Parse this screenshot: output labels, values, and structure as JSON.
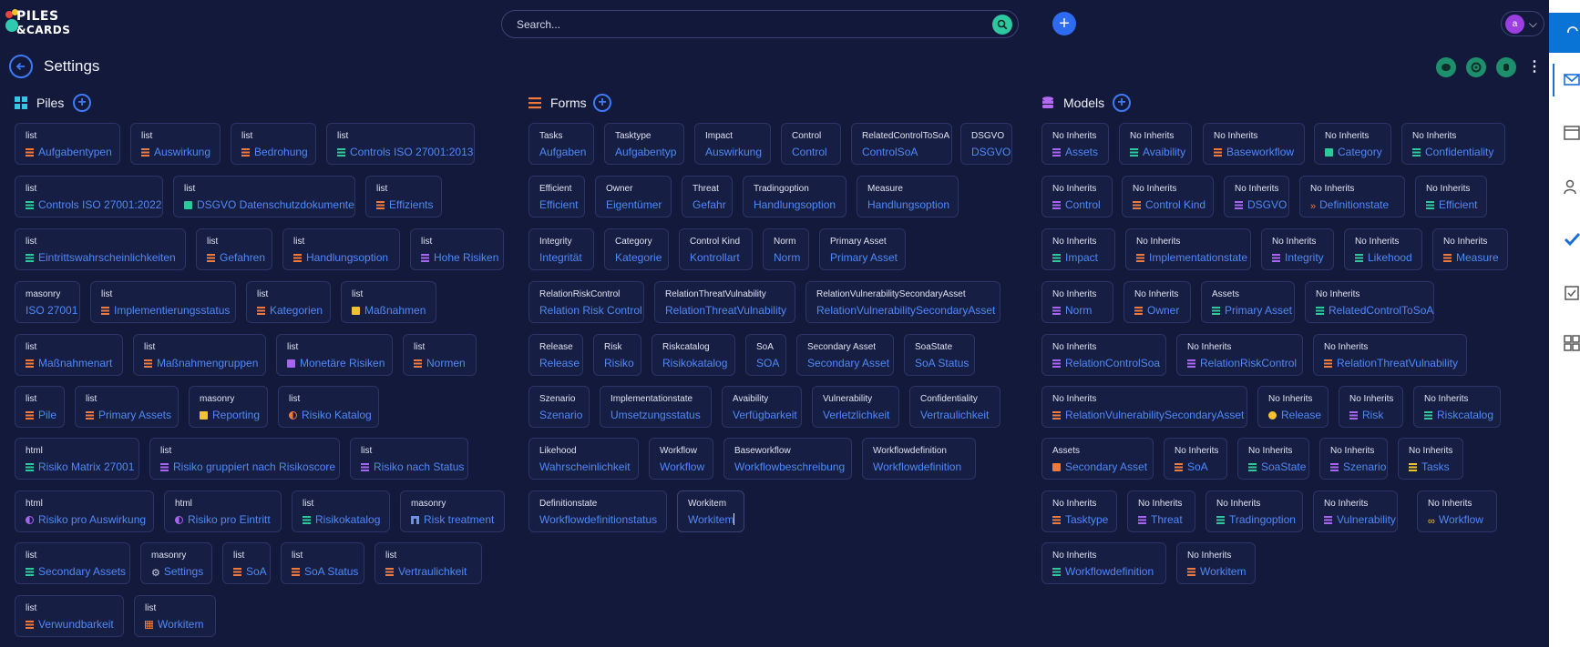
{
  "logo": {
    "line1": "PILES",
    "line2": "&CARDS"
  },
  "search": {
    "placeholder": "Search..."
  },
  "user": {
    "initial": "a"
  },
  "header": {
    "title": "Settings"
  },
  "colors": {
    "accent": "#3d7bf6",
    "green": "#2dc8a0",
    "orange": "#f0793c",
    "purple": "#a865f0",
    "teal": "#2fc89a",
    "yellow": "#f2c230",
    "link": "#4f89f7"
  },
  "columns": {
    "piles": {
      "title": "Piles",
      "icon": "grid-icon"
    },
    "forms": {
      "title": "Forms",
      "icon": "list-icon"
    },
    "models": {
      "title": "Models",
      "icon": "database-icon"
    }
  },
  "piles": [
    {
      "sub": "list",
      "name": "Aufgabentypen",
      "icon": "lines",
      "color": "#f0793c"
    },
    {
      "sub": "list",
      "name": "Auswirkung",
      "icon": "lines",
      "color": "#f0793c"
    },
    {
      "sub": "list",
      "name": "Bedrohung",
      "icon": "lines",
      "color": "#f0793c"
    },
    {
      "sub": "list",
      "name": "Controls ISO 27001:2013",
      "icon": "lines",
      "color": "#2fc89a"
    },
    {
      "sub": "list",
      "name": "Controls ISO 27001:2022",
      "icon": "lines",
      "color": "#2fc89a"
    },
    {
      "sub": "list",
      "name": "DSGVO Datenschutzdokumente",
      "icon": "solid",
      "color": "#2fc89a"
    },
    {
      "sub": "list",
      "name": "Effizients",
      "icon": "lines",
      "color": "#f0793c"
    },
    {
      "sub": "list",
      "name": "Eintrittswahrscheinlichkeiten",
      "icon": "lines",
      "color": "#2fc89a"
    },
    {
      "sub": "list",
      "name": "Gefahren",
      "icon": "lines",
      "color": "#f0793c"
    },
    {
      "sub": "list",
      "name": "Handlungsoption",
      "icon": "lines",
      "color": "#f0793c"
    },
    {
      "sub": "list",
      "name": "Hohe Risiken",
      "icon": "lines",
      "color": "#a865f0"
    },
    {
      "sub": "masonry",
      "name": "ISO 27001",
      "icon": "none",
      "color": ""
    },
    {
      "sub": "list",
      "name": "Implementierungsstatus",
      "icon": "lines",
      "color": "#f0793c"
    },
    {
      "sub": "list",
      "name": "Kategorien",
      "icon": "lines",
      "color": "#f0793c"
    },
    {
      "sub": "list",
      "name": "Maßnahmen",
      "icon": "solid",
      "color": "#f2c230"
    },
    {
      "sub": "list",
      "name": "Maßnahmenart",
      "icon": "lines",
      "color": "#f0793c"
    },
    {
      "sub": "list",
      "name": "Maßnahmengruppen",
      "icon": "lines",
      "color": "#f0793c"
    },
    {
      "sub": "list",
      "name": "Monetäre Risiken",
      "icon": "solid",
      "color": "#a865f0"
    },
    {
      "sub": "list",
      "name": "Normen",
      "icon": "lines",
      "color": "#f0793c"
    },
    {
      "sub": "list",
      "name": "Pile",
      "icon": "lines",
      "color": "#f0793c"
    },
    {
      "sub": "list",
      "name": "Primary Assets",
      "icon": "lines",
      "color": "#f0793c"
    },
    {
      "sub": "masonry",
      "name": "Reporting",
      "icon": "solid",
      "color": "#f2c230"
    },
    {
      "sub": "list",
      "name": "Risiko Katalog",
      "icon": "half",
      "color": "#f0793c"
    },
    {
      "sub": "html",
      "name": "Risiko Matrix 27001",
      "icon": "lines",
      "color": "#2fc89a"
    },
    {
      "sub": "list",
      "name": "Risiko gruppiert nach Risikoscore",
      "icon": "lines",
      "color": "#a865f0"
    },
    {
      "sub": "list",
      "name": "Risiko nach Status",
      "icon": "lines",
      "color": "#a865f0"
    },
    {
      "sub": "html",
      "name": "Risiko pro Auswirkung",
      "icon": "half",
      "color": "#a865f0"
    },
    {
      "sub": "html",
      "name": "Risiko pro Eintritt",
      "icon": "half",
      "color": "#a865f0"
    },
    {
      "sub": "list",
      "name": "Risikokatalog",
      "icon": "lines",
      "color": "#2fc89a"
    },
    {
      "sub": "masonry",
      "name": "Risk treatment",
      "icon": "house",
      "color": "#6f8fe8"
    },
    {
      "sub": "list",
      "name": "Secondary Assets",
      "icon": "lines",
      "color": "#2fc89a"
    },
    {
      "sub": "masonry",
      "name": "Settings",
      "icon": "glyph",
      "color": "#c9cde0"
    },
    {
      "sub": "list",
      "name": "SoA",
      "icon": "lines",
      "color": "#f0793c"
    },
    {
      "sub": "list",
      "name": "SoA Status",
      "icon": "lines",
      "color": "#f0793c"
    },
    {
      "sub": "list",
      "name": "Vertraulichkeit",
      "icon": "lines",
      "color": "#f0793c"
    },
    {
      "sub": "list",
      "name": "Verwundbarkeit",
      "icon": "lines",
      "color": "#f0793c"
    },
    {
      "sub": "list",
      "name": "Workitem",
      "icon": "grid",
      "color": "#f0793c"
    }
  ],
  "forms": [
    {
      "sub": "Tasks",
      "name": "Aufgaben"
    },
    {
      "sub": "Tasktype",
      "name": "Aufgabentyp"
    },
    {
      "sub": "Impact",
      "name": "Auswirkung"
    },
    {
      "sub": "Control",
      "name": "Control"
    },
    {
      "sub": "RelatedControlToSoA",
      "name": "ControlSoA"
    },
    {
      "sub": "DSGVO",
      "name": "DSGVO"
    },
    {
      "sub": "Efficient",
      "name": "Efficient"
    },
    {
      "sub": "Owner",
      "name": "Eigentümer"
    },
    {
      "sub": "Threat",
      "name": "Gefahr"
    },
    {
      "sub": "Tradingoption",
      "name": "Handlungsoption"
    },
    {
      "sub": "Measure",
      "name": "Handlungsoption"
    },
    {
      "sub": "Integrity",
      "name": "Integrität"
    },
    {
      "sub": "Category",
      "name": "Kategorie"
    },
    {
      "sub": "Control Kind",
      "name": "Kontrollart"
    },
    {
      "sub": "Norm",
      "name": "Norm"
    },
    {
      "sub": "Primary Asset",
      "name": "Primary Asset"
    },
    {
      "sub": "RelationRiskControl",
      "name": "Relation Risk Control"
    },
    {
      "sub": "RelationThreatVulnability",
      "name": "RelationThreatVulnability"
    },
    {
      "sub": "RelationVulnerabilitySecondaryAsset",
      "name": "RelationVulnerabilitySecondaryAsset"
    },
    {
      "sub": "Release",
      "name": "Release"
    },
    {
      "sub": "Risk",
      "name": "Risiko"
    },
    {
      "sub": "Riskcatalog",
      "name": "Risikokatalog"
    },
    {
      "sub": "SoA",
      "name": "SOA"
    },
    {
      "sub": "Secondary Asset",
      "name": "Secondary Asset"
    },
    {
      "sub": "SoaState",
      "name": "SoA Status"
    },
    {
      "sub": "Szenario",
      "name": "Szenario"
    },
    {
      "sub": "Implementationstate",
      "name": "Umsetzungsstatus"
    },
    {
      "sub": "Avaibility",
      "name": "Verfügbarkeit"
    },
    {
      "sub": "Vulnerability",
      "name": "Verletzlichkeit"
    },
    {
      "sub": "Confidentiality",
      "name": "Vertraulichkeit"
    },
    {
      "sub": "Likehood",
      "name": "Wahrscheinlichkeit"
    },
    {
      "sub": "Workflow",
      "name": "Workflow"
    },
    {
      "sub": "Baseworkflow",
      "name": "Workflowbeschreibung"
    },
    {
      "sub": "Workflowdefinition",
      "name": "Workflowdefinition"
    },
    {
      "sub": "Definitionstate",
      "name": "Workflowdefinitionstatus"
    },
    {
      "sub": "Workitem",
      "name": "Workitem"
    }
  ],
  "models": [
    {
      "sub": "No Inherits",
      "name": "Assets",
      "icon": "lines",
      "color": "#a865f0"
    },
    {
      "sub": "No Inherits",
      "name": "Avaibility",
      "icon": "lines",
      "color": "#2fc89a"
    },
    {
      "sub": "No Inherits",
      "name": "Baseworkflow",
      "icon": "lines",
      "color": "#f0793c"
    },
    {
      "sub": "No Inherits",
      "name": "Category",
      "icon": "solid",
      "color": "#2fc89a"
    },
    {
      "sub": "No Inherits",
      "name": "Confidentiality",
      "icon": "lines",
      "color": "#2fc89a"
    },
    {
      "sub": "No Inherits",
      "name": "Control",
      "icon": "lines",
      "color": "#a865f0"
    },
    {
      "sub": "No Inherits",
      "name": "Control Kind",
      "icon": "lines",
      "color": "#f0793c"
    },
    {
      "sub": "No Inherits",
      "name": "DSGVO",
      "icon": "lines",
      "color": "#a865f0"
    },
    {
      "sub": "No Inherits",
      "name": "Definitionstate",
      "icon": "glyph",
      "color": "#f0793c"
    },
    {
      "sub": "No Inherits",
      "name": "Efficient",
      "icon": "lines",
      "color": "#2fc89a"
    },
    {
      "sub": "No Inherits",
      "name": "Impact",
      "icon": "lines",
      "color": "#2fc89a"
    },
    {
      "sub": "No Inherits",
      "name": "Implementationstate",
      "icon": "lines",
      "color": "#f0793c"
    },
    {
      "sub": "No Inherits",
      "name": "Integrity",
      "icon": "lines",
      "color": "#a865f0"
    },
    {
      "sub": "No Inherits",
      "name": "Likehood",
      "icon": "lines",
      "color": "#2fc89a"
    },
    {
      "sub": "No Inherits",
      "name": "Measure",
      "icon": "lines",
      "color": "#f0793c"
    },
    {
      "sub": "No Inherits",
      "name": "Norm",
      "icon": "lines",
      "color": "#a865f0"
    },
    {
      "sub": "No Inherits",
      "name": "Owner",
      "icon": "lines",
      "color": "#f0793c"
    },
    {
      "sub": "Assets",
      "name": "Primary Asset",
      "icon": "lines",
      "color": "#2fc89a"
    },
    {
      "sub": "No Inherits",
      "name": "RelatedControlToSoA",
      "icon": "lines",
      "color": "#2fc89a"
    },
    {
      "sub": "No Inherits",
      "name": "RelationControlSoa",
      "icon": "lines",
      "color": "#a865f0"
    },
    {
      "sub": "No Inherits",
      "name": "RelationRiskControl",
      "icon": "lines",
      "color": "#a865f0"
    },
    {
      "sub": "No Inherits",
      "name": "RelationThreatVulnability",
      "icon": "lines",
      "color": "#f0793c"
    },
    {
      "sub": "No Inherits",
      "name": "RelationVulnerabilitySecondaryAsset",
      "icon": "lines",
      "color": "#f0793c"
    },
    {
      "sub": "No Inherits",
      "name": "Release",
      "icon": "circle",
      "color": "#f2c230"
    },
    {
      "sub": "No Inherits",
      "name": "Risk",
      "icon": "lines",
      "color": "#a865f0"
    },
    {
      "sub": "No Inherits",
      "name": "Riskcatalog",
      "icon": "lines",
      "color": "#2fc89a"
    },
    {
      "sub": "Assets",
      "name": "Secondary Asset",
      "icon": "solid",
      "color": "#f0793c"
    },
    {
      "sub": "No Inherits",
      "name": "SoA",
      "icon": "lines",
      "color": "#f0793c"
    },
    {
      "sub": "No Inherits",
      "name": "SoaState",
      "icon": "lines",
      "color": "#2fc89a"
    },
    {
      "sub": "No Inherits",
      "name": "Szenario",
      "icon": "lines",
      "color": "#a865f0"
    },
    {
      "sub": "No Inherits",
      "name": "Tasks",
      "icon": "lines",
      "color": "#f2c230"
    },
    {
      "sub": "No Inherits",
      "name": "Tasktype",
      "icon": "lines",
      "color": "#f0793c"
    },
    {
      "sub": "No Inherits",
      "name": "Threat",
      "icon": "lines",
      "color": "#a865f0"
    },
    {
      "sub": "No Inherits",
      "name": "Tradingoption",
      "icon": "lines",
      "color": "#2fc89a"
    },
    {
      "sub": "No Inherits",
      "name": "Vulnerability",
      "icon": "lines",
      "color": "#a865f0"
    },
    {
      "sub": "No Inherits",
      "name": "Workflow",
      "icon": "glyph",
      "color": "#f2c230"
    },
    {
      "sub": "No Inherits",
      "name": "Workflowdefinition",
      "icon": "lines",
      "color": "#2fc89a"
    },
    {
      "sub": "No Inherits",
      "name": "Workitem",
      "icon": "lines",
      "color": "#f0793c"
    }
  ]
}
